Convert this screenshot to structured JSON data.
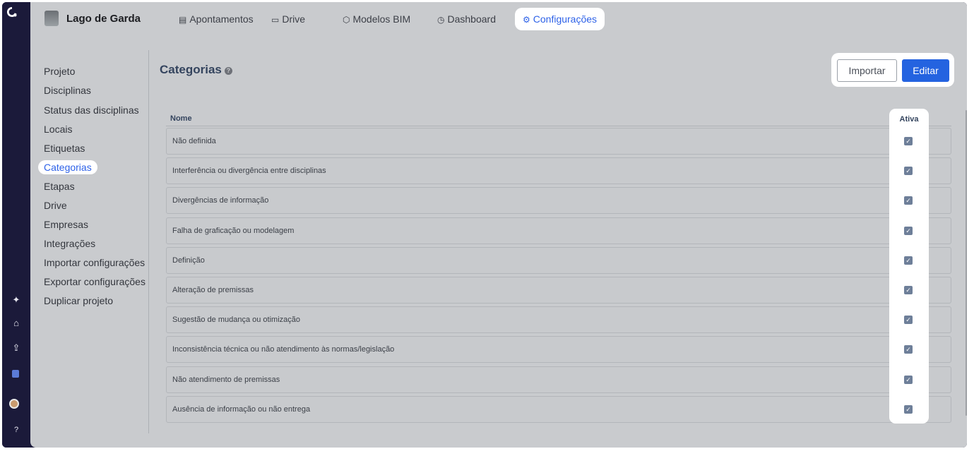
{
  "app": {
    "project_name": "Lago de Garda"
  },
  "tabs": [
    {
      "label": "Apontamentos",
      "icon": "document-icon",
      "active": false
    },
    {
      "label": "Drive",
      "icon": "folder-icon",
      "active": false
    },
    {
      "label": "Modelos BIM",
      "icon": "cube-icon",
      "active": false
    },
    {
      "label": "Dashboard",
      "icon": "pie-chart-icon",
      "active": false
    },
    {
      "label": "Configurações",
      "icon": "gear-icon",
      "active": true
    }
  ],
  "sidebar": {
    "items": [
      {
        "label": "Projeto"
      },
      {
        "label": "Disciplinas"
      },
      {
        "label": "Status das disciplinas"
      },
      {
        "label": "Locais"
      },
      {
        "label": "Etiquetas"
      },
      {
        "label": "Categorias",
        "active": true
      },
      {
        "label": "Etapas"
      },
      {
        "label": "Drive"
      },
      {
        "label": "Empresas"
      },
      {
        "label": "Integrações"
      },
      {
        "label": "Importar configurações"
      },
      {
        "label": "Exportar configurações"
      },
      {
        "label": "Duplicar projeto"
      }
    ]
  },
  "page": {
    "title": "Categorias",
    "help_glyph": "?",
    "import_label": "Importar",
    "edit_label": "Editar"
  },
  "table": {
    "col_name": "Nome",
    "col_active": "Ativa",
    "rows": [
      {
        "name": "Não definida",
        "active": true
      },
      {
        "name": "Interferência ou divergência entre disciplinas",
        "active": true
      },
      {
        "name": "Divergências de informação",
        "active": true
      },
      {
        "name": "Falha de graficação ou modelagem",
        "active": true
      },
      {
        "name": "Definição",
        "active": true
      },
      {
        "name": "Alteração de premissas",
        "active": true
      },
      {
        "name": "Sugestão de mudança ou otimização",
        "active": true
      },
      {
        "name": "Inconsistência técnica ou não atendimento às normas/legislação",
        "active": true
      },
      {
        "name": "Não atendimento de premissas",
        "active": true
      },
      {
        "name": "Ausência de informação ou não entrega",
        "active": true
      }
    ]
  },
  "rail": {
    "help_glyph": "?"
  },
  "colors": {
    "accent": "#2463e0",
    "rail": "#1b1a3a",
    "overlay": "#c9cbce"
  }
}
